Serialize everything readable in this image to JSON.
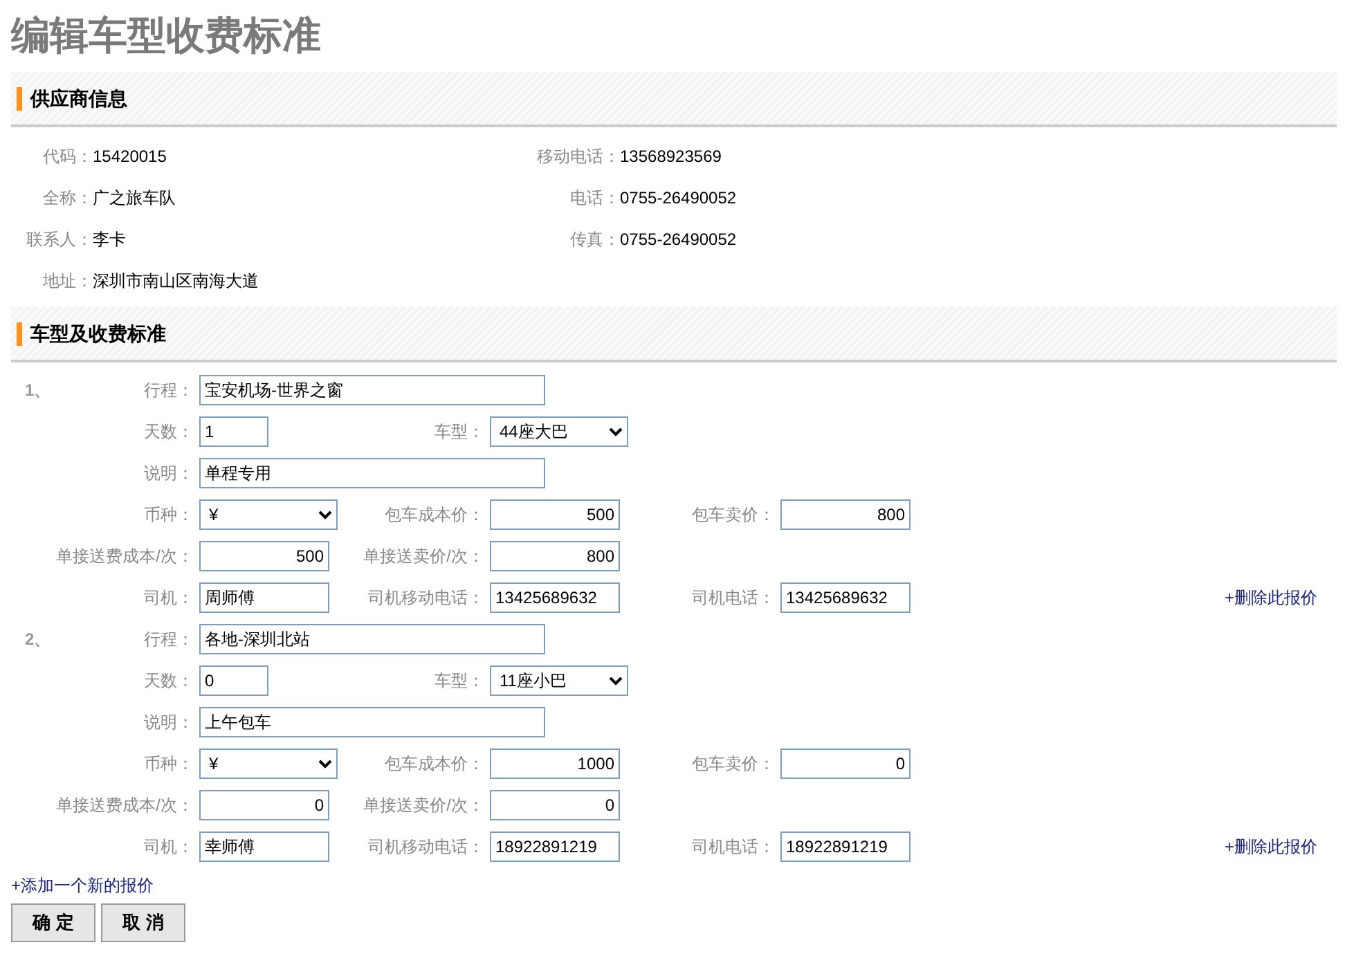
{
  "page_title": "编辑车型收费标准",
  "supplier": {
    "heading": "供应商信息",
    "rows": [
      [
        {
          "label": "代码：",
          "value": "15420015"
        },
        {
          "label": "移动电话：",
          "value": "13568923569"
        }
      ],
      [
        {
          "label": "全称：",
          "value": "广之旅车队"
        },
        {
          "label": "电话：",
          "value": "0755-26490052"
        }
      ],
      [
        {
          "label": "联系人：",
          "value": "李卡"
        },
        {
          "label": "传真：",
          "value": "0755-26490052"
        }
      ],
      [
        {
          "label": "地址：",
          "value": "深圳市南山区南海大道"
        }
      ]
    ]
  },
  "rates": {
    "heading": "车型及收费标准",
    "quotes": [
      {
        "number": "1、",
        "delete_link": "+删除此报价",
        "rows": [
          [
            {
              "label": "行程：",
              "kind": "text",
              "value": "宝安机场-世界之窗"
            }
          ],
          [
            {
              "label": "天数：",
              "kind": "text",
              "value": "1"
            },
            {
              "label": "车型：",
              "kind": "select",
              "value": "44座大巴"
            }
          ],
          [
            {
              "label": "说明：",
              "kind": "text",
              "value": "单程专用"
            }
          ],
          [
            {
              "label": "币种：",
              "kind": "select",
              "value": "¥"
            },
            {
              "label": "包车成本价：",
              "kind": "number",
              "value": "500"
            },
            {
              "label": "包车卖价：",
              "kind": "number",
              "value": "800"
            }
          ],
          [
            {
              "label": "单接送费成本/次：",
              "kind": "number",
              "value": "500"
            },
            {
              "label": "单接送卖价/次：",
              "kind": "number",
              "value": "800"
            }
          ],
          [
            {
              "label": "司机：",
              "kind": "text",
              "value": "周师傅"
            },
            {
              "label": "司机移动电话：",
              "kind": "text",
              "value": "13425689632"
            },
            {
              "label": "司机电话：",
              "kind": "text",
              "value": "13425689632"
            }
          ]
        ]
      },
      {
        "number": "2、",
        "delete_link": "+删除此报价",
        "rows": [
          [
            {
              "label": "行程：",
              "kind": "text",
              "value": "各地-深圳北站"
            }
          ],
          [
            {
              "label": "天数：",
              "kind": "text",
              "value": "0"
            },
            {
              "label": "车型：",
              "kind": "select",
              "value": "11座小巴"
            }
          ],
          [
            {
              "label": "说明：",
              "kind": "text",
              "value": "上午包车"
            }
          ],
          [
            {
              "label": "币种：",
              "kind": "select",
              "value": "¥"
            },
            {
              "label": "包车成本价：",
              "kind": "number",
              "value": "1000"
            },
            {
              "label": "包车卖价：",
              "kind": "number",
              "value": "0"
            }
          ],
          [
            {
              "label": "单接送费成本/次：",
              "kind": "number",
              "value": "0"
            },
            {
              "label": "单接送卖价/次：",
              "kind": "number",
              "value": "0"
            }
          ],
          [
            {
              "label": "司机：",
              "kind": "text",
              "value": "幸师傅"
            },
            {
              "label": "司机移动电话：",
              "kind": "text",
              "value": "18922891219"
            },
            {
              "label": "司机电话：",
              "kind": "text",
              "value": "18922891219"
            }
          ]
        ]
      }
    ],
    "add_link": "+添加一个新的报价"
  },
  "buttons": [
    "确 定",
    "取 消"
  ]
}
